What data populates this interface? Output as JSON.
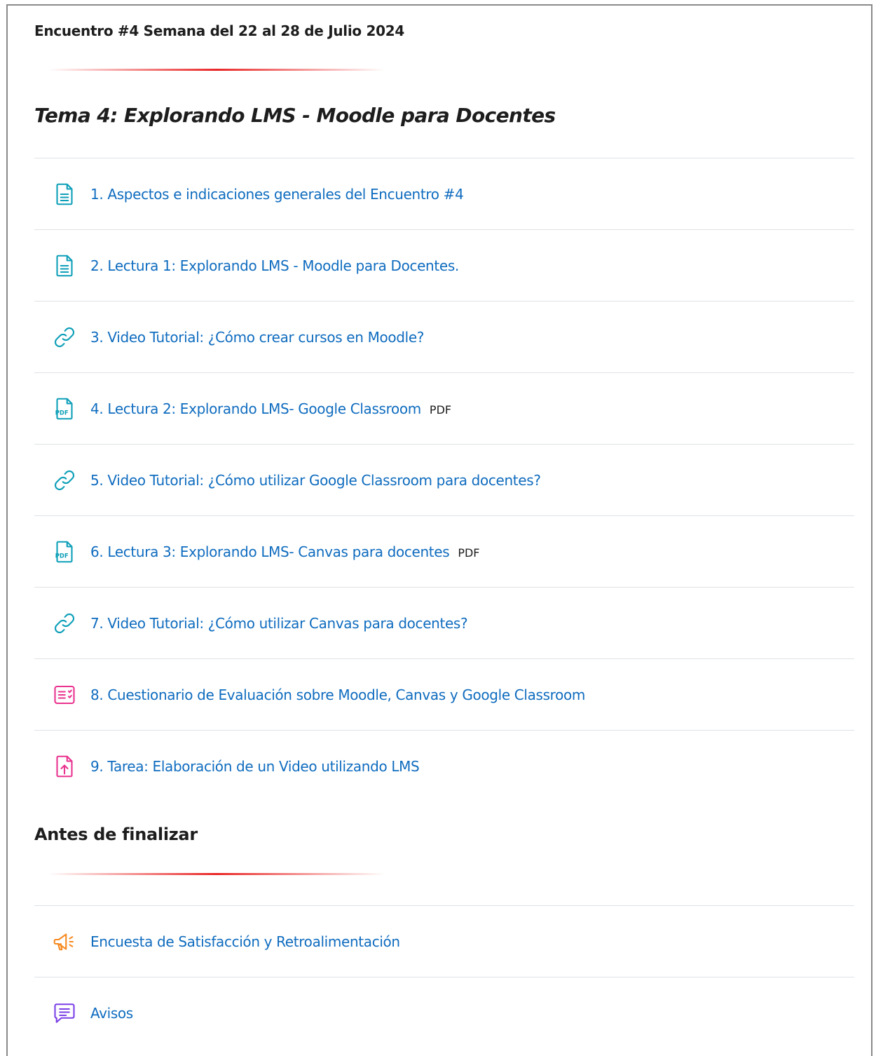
{
  "section": {
    "week_title": "Encuentro #4 Semana del 22 al 28 de Julio 2024",
    "topic_title": "Tema 4: Explorando LMS - Moodle para Docentes"
  },
  "activities": [
    {
      "label": "1. Aspectos e indicaciones generales del Encuentro #4",
      "icon": "page-icon",
      "tag": ""
    },
    {
      "label": "2. Lectura 1: Explorando LMS - Moodle para Docentes.",
      "icon": "page-icon",
      "tag": ""
    },
    {
      "label": "3. Video Tutorial: ¿Cómo crear cursos en Moodle?",
      "icon": "url-link-icon",
      "tag": ""
    },
    {
      "label": "4. Lectura 2: Explorando LMS- Google Classroom",
      "icon": "pdf-file-icon",
      "tag": "PDF"
    },
    {
      "label": "5. Video Tutorial: ¿Cómo utilizar Google Classroom para docentes?",
      "icon": "url-link-icon",
      "tag": ""
    },
    {
      "label": "6. Lectura 3: Explorando LMS- Canvas para docentes",
      "icon": "pdf-file-icon",
      "tag": "PDF"
    },
    {
      "label": "7. Video Tutorial: ¿Cómo utilizar Canvas para docentes?",
      "icon": "url-link-icon",
      "tag": ""
    },
    {
      "label": "8. Cuestionario de Evaluación sobre Moodle, Canvas y Google Classroom",
      "icon": "quiz-icon",
      "tag": ""
    },
    {
      "label": "9. Tarea: Elaboración de un Video utilizando LMS",
      "icon": "assignment-upload-icon",
      "tag": ""
    }
  ],
  "closing": {
    "title": "Antes de finalizar",
    "items": [
      {
        "label": "Encuesta de Satisfacción y Retroalimentación",
        "icon": "feedback-megaphone-icon"
      },
      {
        "label": "Avisos",
        "icon": "forum-message-icon"
      }
    ]
  },
  "colors": {
    "link": "#0f6cbf",
    "resource_icon": "#0d9fb8",
    "assessment_icon": "#e9338f",
    "feedback_icon": "#f7891f",
    "forum_icon": "#7a3fe6",
    "divider_accent": "#e60000"
  }
}
